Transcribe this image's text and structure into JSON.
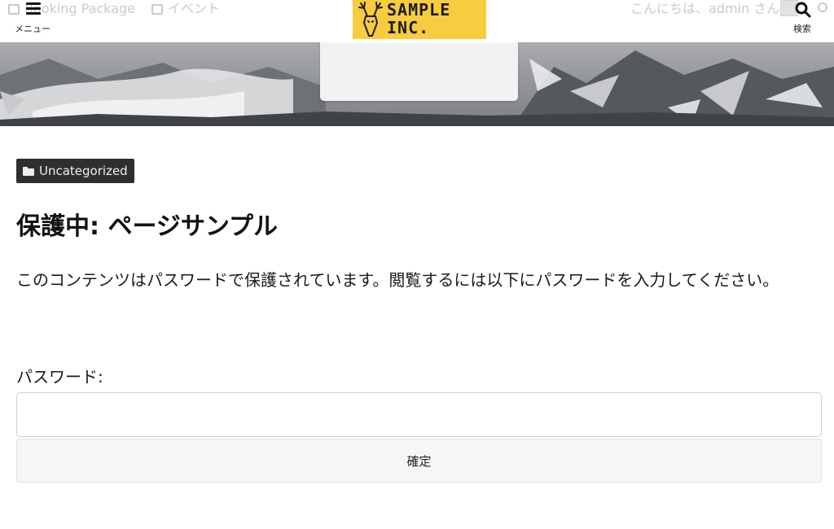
{
  "admin_bar": {
    "booking_label": "Booking Package",
    "event_label": "イベント",
    "greeting": "こんにちは、admin さん"
  },
  "header": {
    "menu_label": "メニュー",
    "logo_text_line1": "SAMPLE",
    "logo_text_line2": "INC.",
    "search_label": "検索",
    "brand_color": "#f7cc3f"
  },
  "post": {
    "category": "Uncategorized",
    "title": "保護中: ページサンプル",
    "protected_message": "このコンテンツはパスワードで保護されています。閲覧するには以下にパスワードを入力してください。"
  },
  "password_form": {
    "label": "パスワード:",
    "value": "",
    "submit_label": "確定"
  },
  "icons": [
    "calendar-icon",
    "menu-icon",
    "deer-logo-icon",
    "search-icon",
    "folder-icon"
  ]
}
